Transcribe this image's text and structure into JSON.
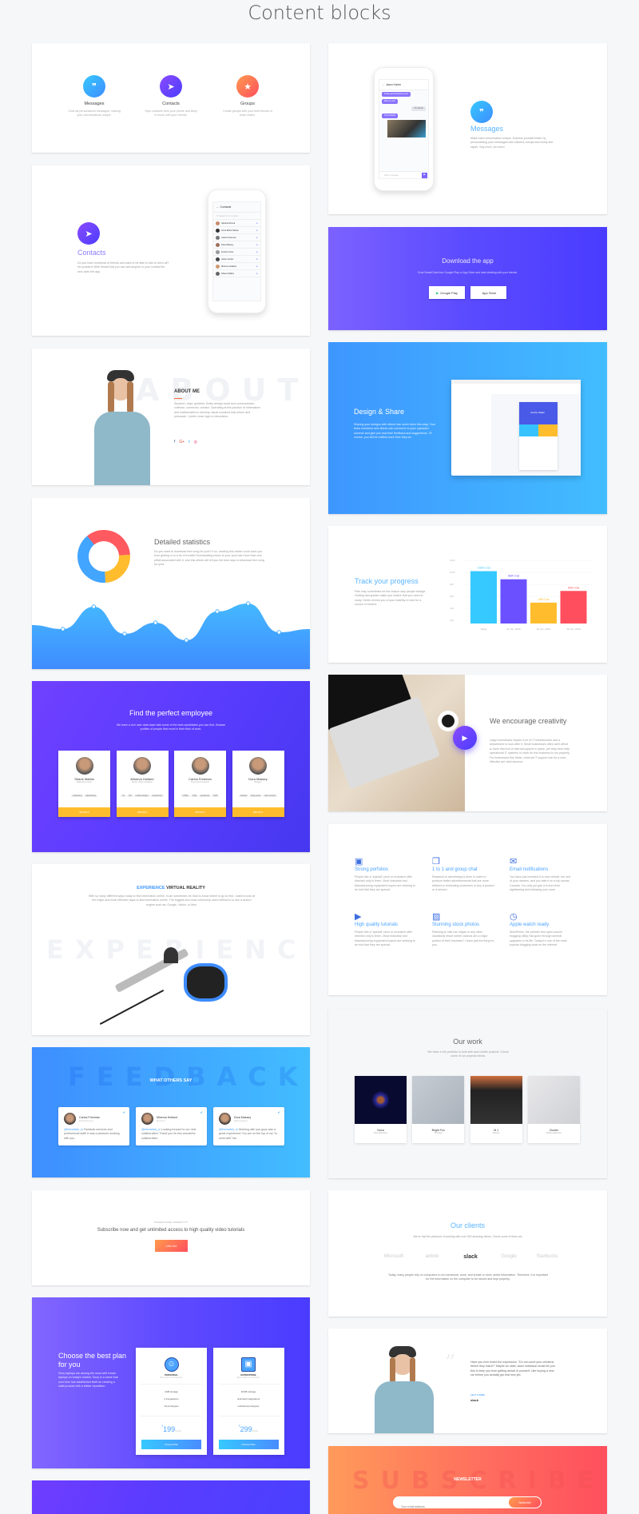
{
  "page_title": "Content blocks",
  "colors": {
    "blue": "#3e96ff",
    "purple": "#5b3dff",
    "orange": "#ff7a55",
    "yellow": "#ffbd2e",
    "red": "#ff4f5e"
  },
  "features3": [
    {
      "icon": "message-icon",
      "title": "Messages",
      "text": "Chat via personalized messages, making your conversations unique."
    },
    {
      "icon": "send-icon",
      "title": "Contacts",
      "text": "Sync contacts from your phone and keep in touch with your friends."
    },
    {
      "icon": "star-icon",
      "title": "Groups",
      "text": "Create groups with your best friends or team mates."
    }
  ],
  "contacts": {
    "icon": "send-icon",
    "title": "Contacts",
    "text": "Do you have hundreds of friends and want to be able to talk to them all? No problem! With SmartChat you can add anyone in your contact list who uses the app.",
    "phone_header": "Contacts",
    "search_placeholder": "Search for contact",
    "list": [
      "Adriana Rivera",
      "Anna Marie Nelson",
      "Carlos Freeman",
      "Dora Massey",
      "Francis Frost",
      "Jason Hunter",
      "Minerva Holland",
      "Shane Mathis"
    ]
  },
  "messages": {
    "icon": "message-icon",
    "title": "Messages",
    "text": "Make each conversation unique. Express yourself better by personalizing your messages with stickers, emojis and lovely text styles. Say more, do more!",
    "chat_name": "Jason Hunter",
    "input_placeholder": "Write a message",
    "bubbles": [
      "Finally got that photo to you!",
      "Was so cool!",
      "Oh thanks!",
      "This is Brazil!"
    ]
  },
  "download": {
    "title": "Download the app",
    "text": "Grab SmartChat from Google Play or App Store and start chatting with your friends.",
    "google_play": "Google Play",
    "app_store": "App Store"
  },
  "about": {
    "watermark": "ABOUT",
    "title": "ABOUT ME",
    "text": "Skydiver, ninja, guitarist, Swiss design-head and communicator, collector, connector, creator. Operating at the junction of minimalism and mathematics to develop visual solutions that inform and persuade. I prefer clear logic to decoration.",
    "social": [
      "facebook-icon",
      "google-plus-icon",
      "twitter-icon",
      "instagram-icon"
    ]
  },
  "design": {
    "title": "Design & Share",
    "text": "Sharing your designs with others has never been this easy. Your team members and clients can comment on your uploaded screens and give you real-time feedback and suggestions. Of course, you will be notified each time they do.",
    "mock_profile": "Jennifer Walker"
  },
  "stats": {
    "title": "Detailed statistics",
    "text": "Do you want to download free song for ipod? If so, reading this article could save you from getting in to a lot of trouble! Downloading music to your Ipod has more than one pitfall associated with it, and this article will tell you the best way to download free song for Ipod."
  },
  "track": {
    "title": "Track your progress",
    "text": "Pain may sometimes be the reason why people change. Getting bad grades make you realize that you need to study. Debts remind you of your inability to look for a source of income."
  },
  "chart_data": [
    {
      "type": "pie",
      "donut": true,
      "values": [
        35,
        25,
        40
      ],
      "colors": [
        "#ff5a5f",
        "#ffbd2e",
        "#42a5ff"
      ]
    },
    {
      "type": "area",
      "values": [
        55,
        50,
        78,
        44,
        58,
        36,
        72,
        82,
        46,
        50
      ],
      "color": "#42aaff"
    },
    {
      "type": "bar",
      "categories": [
        "Today",
        "21 Jun, 2016",
        "19 Jun, 2016",
        "15 Jun, 2016"
      ],
      "values": [
        1020,
        884,
        495,
        690
      ],
      "labels": [
        "1020 Cal",
        "884 Cal",
        "495 Cal",
        "690 Cal"
      ],
      "yticks": [
        1200,
        1000,
        800,
        600,
        400,
        200
      ],
      "colors": [
        "#36c9ff",
        "#6a50ff",
        "#ffbd2e",
        "#ff4f5e"
      ],
      "grid": true
    }
  ],
  "employee": {
    "title": "Find the perfect employee",
    "text": "We have a rich user data base with some of the best candidates you can find. Browse profiles of people that excel in their filed of work.",
    "people": [
      {
        "name": "Shane Mathis",
        "role": "Marketing expert",
        "tags": [
          "marketing",
          "advertising",
          "email marketing"
        ],
        "more": "+4",
        "button": "DETAILS"
      },
      {
        "name": "Minerva Holland",
        "role": "Senior UI/UX Designer",
        "tags": [
          "UI",
          "UX",
          "mobile design",
          "photoshop",
          "sketch"
        ],
        "more": "+4",
        "button": "DETAILS"
      },
      {
        "name": "Carlos Freeman",
        "role": "Front-end developer",
        "tags": [
          "HTML",
          "CSS",
          "javascript",
          "PHP",
          "Linux",
          "Net"
        ],
        "more": "+5",
        "button": "DETAILS"
      },
      {
        "name": "Dora Massey",
        "role": "Blogger",
        "tags": [
          "articles",
          "blog posts",
          "web content",
          "writing"
        ],
        "more": "+6",
        "button": "DETAILS"
      }
    ]
  },
  "creativity": {
    "title": "We encourage creativity",
    "text": "Large businesses require a lot of IT infrastructure and a department to look after it. Small businesses often can't afford to have that sort of internal support in place, yet they need fully operational IT systems in order for the business to run properly. For businesses like these, external IT support can be a cost-effective yet vital resource."
  },
  "vr": {
    "title_accent": "EXPERIENCE",
    "title_rest": " VIRTUAL REALITY",
    "text": "With so many different ways today to find information online, it can sometimes be hard to know where to go to first. I want to look at the major and most effective ways to find information online. The biggest and most commonly used method is to use a search engine such as: Google, Yahoo, or Msn.",
    "watermark": "EXPERIENCE"
  },
  "features6": [
    {
      "icon": "briefcase-icon",
      "title": "Strong porfolios",
      "text": "People like a \"special\" price or exclusive offer directed only to them. Most Industrial and Manufacturing equipment buyers are seeking to be told that they are special."
    },
    {
      "icon": "chat-icon",
      "title": "1 to 1 and group chat",
      "text": "Research in advertising is done in order to produce better advertisements that are more efficient in motivating customers to buy a product or a service."
    },
    {
      "icon": "envelope-icon",
      "title": "Email notifications",
      "text": "You have just invested in a new vehicle, the one of your dreams, and you take it on a trip across Canada. You only put gas in it and drive sightseeing and following your nose."
    },
    {
      "icon": "video-icon",
      "title": "High quality tutorials",
      "text": "People like a \"special\" price or exclusive offer directed only to them. Most Industrial and Manufacturing equipment buyers are seeking to be told that they are special."
    },
    {
      "icon": "image-icon",
      "title": "Stunning stock photos",
      "text": "Planning to visit Las Vegas or any other vacational resort where casinos are a major portion of their business? I have just the thing for you."
    },
    {
      "icon": "watch-icon",
      "title": "Apple watch ready",
      "text": "WordPress, the premier free open-source blogging utility, has gone through several upgrades in its life. Today it's one of the most popular blogging tools on the internet."
    }
  ],
  "feedback": {
    "watermark": "FEEDBACK",
    "title": "WHAT OTHERS SAY",
    "items": [
      {
        "name": "Carlos Freeman",
        "handle": "@carlosfreeman",
        "mention": "@themeisle_ui",
        "text": " Fantastic services and professional staff! It was a pleasure working with you."
      },
      {
        "name": "Minerva Holland",
        "handle": "@minerva",
        "mention": "@themeisle_ui",
        "text": " Looking forward to our next collaboration! Thank you for this wonderful collaboration."
      },
      {
        "name": "Dora Massey",
        "handle": "@dora.designer",
        "mention": "@themeisle_ui",
        "text": " Working with you guys was a great experience! You are on the top of my \"to work with\" list."
      }
    ]
  },
  "work": {
    "title": "Our work",
    "text": "We have a rich portfolio in both web and mobile projects. Check some of our projects below.",
    "items": [
      {
        "name": "Nova",
        "type": "Web application"
      },
      {
        "name": "Bright Fox",
        "type": "Branding"
      },
      {
        "name": "M J",
        "type": "Website"
      },
      {
        "name": "Cluster",
        "type": "Mobile application"
      }
    ]
  },
  "cta": {
    "eyebrow": "SOUNDS GOOD, DOESN'T IT?",
    "title": "Subscribe now and get unlimited access to high quality video tutorials",
    "button": "Let's Go!"
  },
  "clients": {
    "title": "Our clients",
    "text": "We've had the pleasure of working with over 500 amazing clients. Check some of them out",
    "logos": [
      "Microsoft",
      "airbnb",
      "slack",
      "Google",
      "Starbucks"
    ],
    "footer": "Today, many people rely on computers to do homework, work, and create or store useful information. Therefore, it is important for the information on the computer to be stored and kept properly."
  },
  "pricing": {
    "title": "Choose the best plan for you",
    "text": "Sony laptops are among the most well known laptops on today's market. Sony is a name that over time has established itself as creating a solid product with a stellar reputation.",
    "plans": [
      {
        "icon": "user-icon",
        "name": "PERSONAL",
        "sub": "Best option for freelancers",
        "features": [
          "1GB storage",
          "2 integrations",
          "10 prototypes"
        ],
        "currency": "$",
        "price": "199",
        "period": "/month",
        "button": "Choose Plan"
      },
      {
        "icon": "briefcase-icon",
        "name": "ENTERPRISE",
        "sub": "Best option for companies",
        "features": [
          "10GB storage",
          "unlimited integrations",
          "unlimited prototypes"
        ],
        "currency": "$",
        "price": "299",
        "period": "/month",
        "button": "Choose Plan"
      }
    ]
  },
  "testimonial": {
    "quote": "Have you ever heard the expression, \"Do not count your chickens before they hatch?\" Maybe an older, wiser individual would tell you this to keep you from getting ahead of yourself. Like buying a new car before you actually got that new job.",
    "name": "LILLY LYONS",
    "company": "slack"
  },
  "newsletter": {
    "watermark": "SUBSCRIBE",
    "title": "NEWSLETTER",
    "placeholder": "Your email address",
    "button": "Subscribe"
  }
}
